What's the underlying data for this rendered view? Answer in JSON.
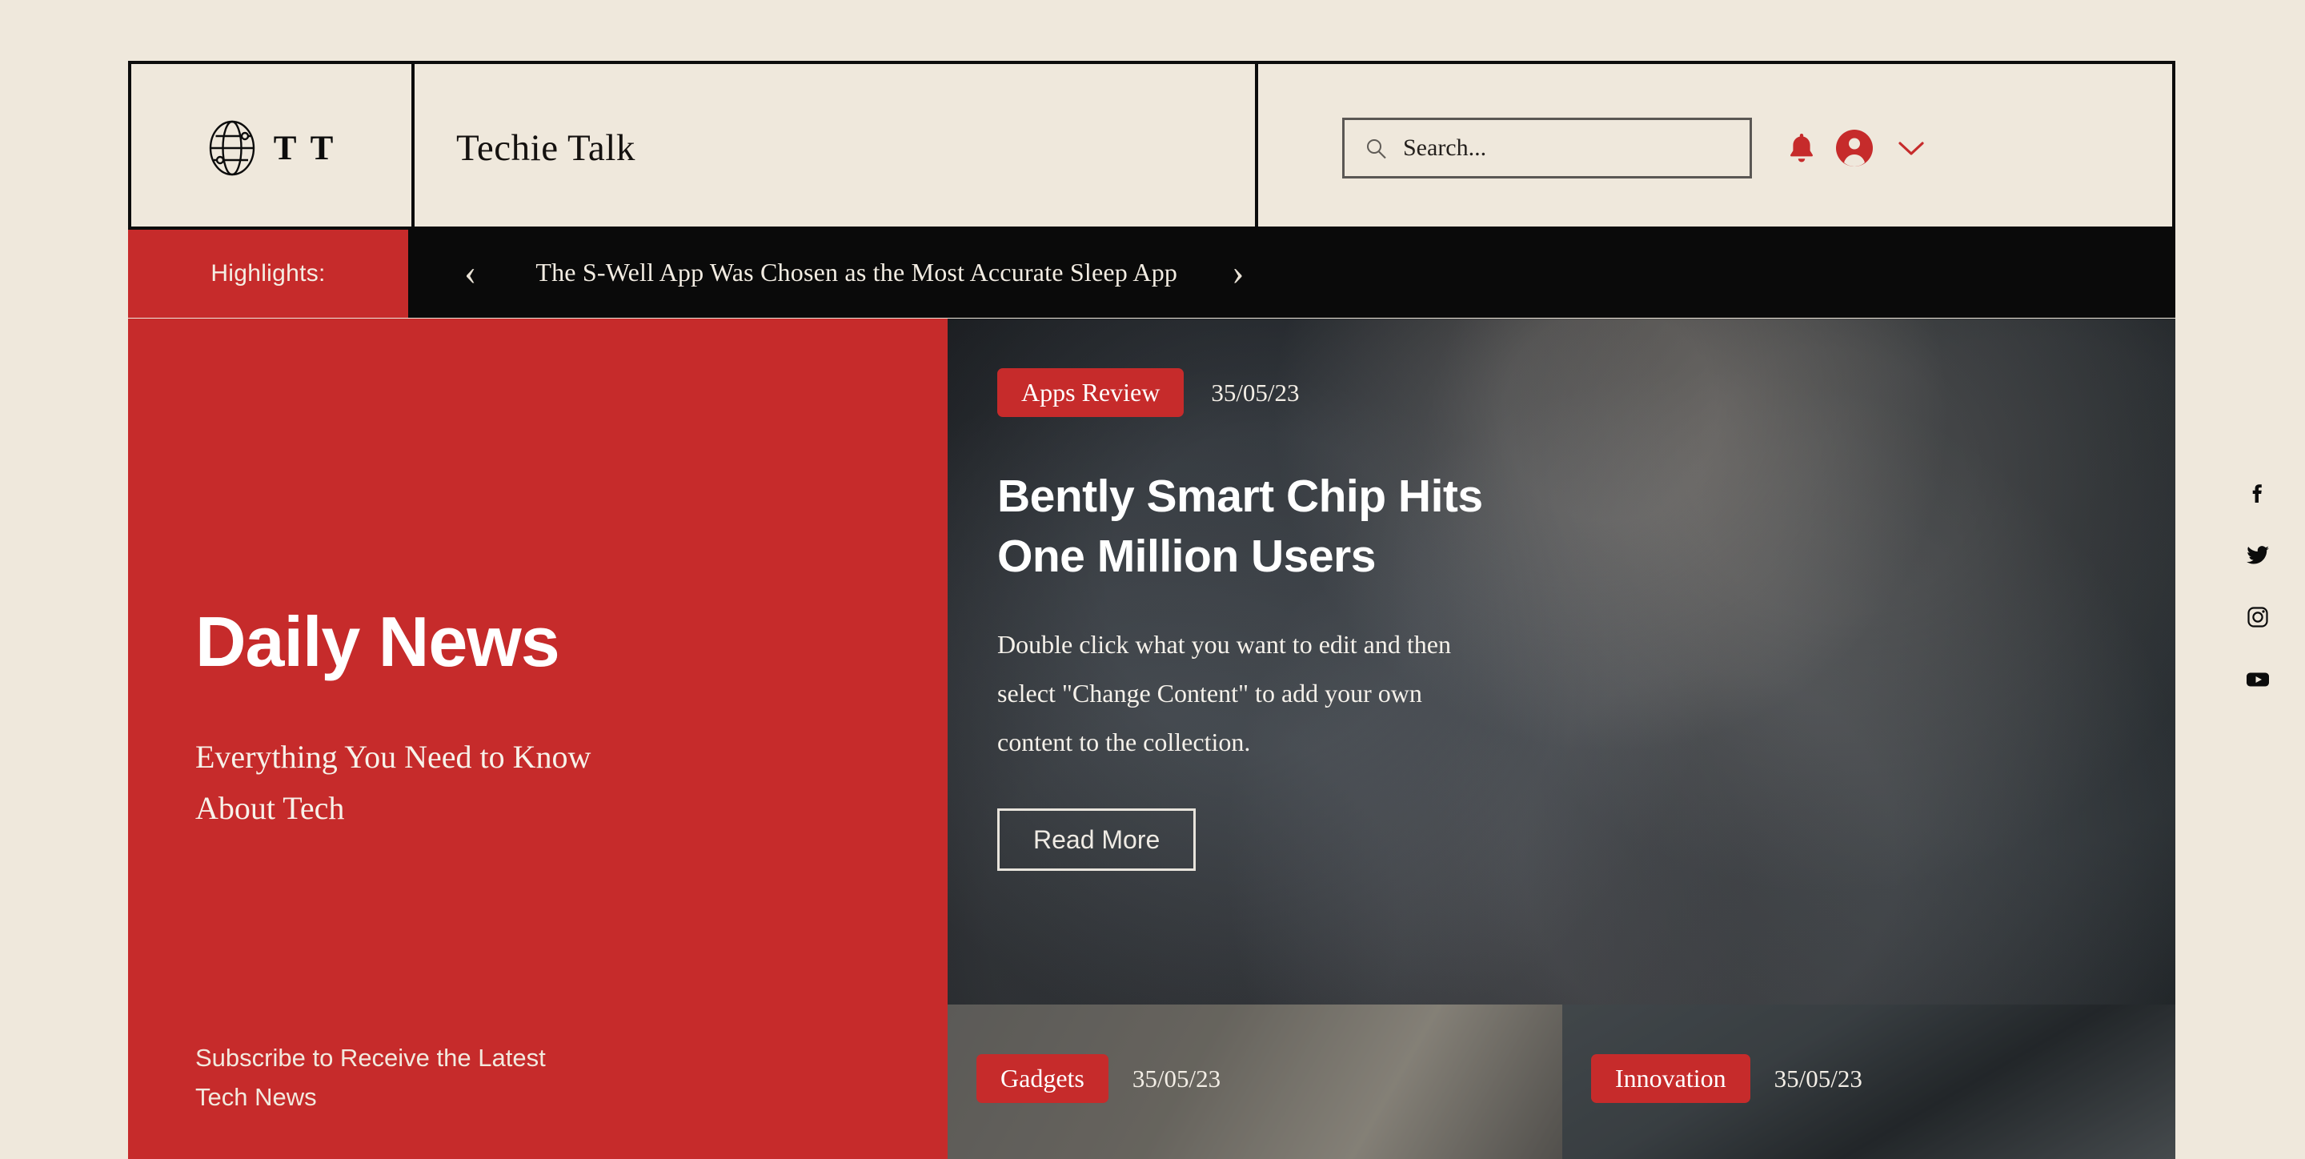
{
  "colors": {
    "background": "#EFE8DC",
    "accent_red": "#C62B2B",
    "ink": "#0C0C0C",
    "ribbon_black": "#0A0A0A"
  },
  "header": {
    "logo_letters": "T T",
    "logo_icon": "globe-icon",
    "brand": "Techie Talk",
    "search": {
      "placeholder": "Search...",
      "value": "",
      "icon": "search-icon"
    },
    "icons": {
      "notifications": "bell-icon",
      "account": "user-avatar-icon",
      "dropdown": "chevron-down-icon"
    }
  },
  "highlights": {
    "label": "Highlights:",
    "prev": "‹",
    "next": "›",
    "headline": "The S-Well App Was Chosen as the Most Accurate Sleep App"
  },
  "hero": {
    "title": "Daily News",
    "subtitle": "Everything You Need to Know About Tech",
    "subscribe": "Subscribe to Receive the Latest Tech News"
  },
  "feature": {
    "tag": "Apps Review",
    "date": "35/05/23",
    "headline": "Bently Smart Chip Hits One Million Users",
    "body": "Double click what you want to edit and then select \"Change Content\" to add your own content to the collection.",
    "cta": "Read More"
  },
  "cards": [
    {
      "tag": "Gadgets",
      "date": "35/05/23"
    },
    {
      "tag": "Innovation",
      "date": "35/05/23"
    }
  ],
  "social": [
    {
      "name": "facebook-icon"
    },
    {
      "name": "twitter-icon"
    },
    {
      "name": "instagram-icon"
    },
    {
      "name": "youtube-icon"
    }
  ]
}
